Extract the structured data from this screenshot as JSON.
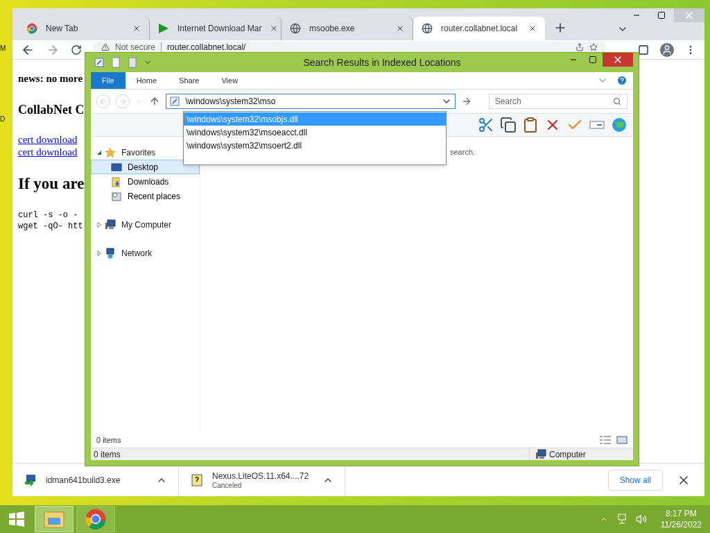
{
  "desktop_labels": [
    "M",
    "D"
  ],
  "browser": {
    "tabs": [
      {
        "title": "New Tab",
        "selected": false
      },
      {
        "title": "Internet Download Mar",
        "selected": false
      },
      {
        "title": "msoobe.exe",
        "selected": false
      },
      {
        "title": "router.collabnet.local",
        "selected": true
      }
    ],
    "security": "Not secure",
    "url": "router.collabnet.local/",
    "page": [
      {
        "kind": "bold",
        "text": "news: no more"
      },
      {
        "kind": "heading",
        "text": "CollabNet C"
      },
      {
        "kind": "link",
        "text": "cert download"
      },
      {
        "kind": "link",
        "text": "cert download"
      },
      {
        "kind": "big",
        "text": "If you are"
      },
      {
        "kind": "code",
        "text": "curl -s -o -"
      },
      {
        "kind": "code",
        "text": "wget -qO- htt"
      }
    ],
    "downloads": [
      {
        "name": "idman641build3.exe"
      },
      {
        "name": "Nexus.LiteOS.11.x64....72",
        "status": "Canceled"
      }
    ],
    "show_all": "Show all"
  },
  "explorer": {
    "title": "Search Results in Indexed Locations",
    "ribbon_tabs": [
      {
        "label": "File",
        "selected": true
      },
      {
        "label": "Home",
        "selected": false
      },
      {
        "label": "Share",
        "selected": false
      },
      {
        "label": "View",
        "selected": false
      }
    ],
    "address": "\\windows\\system32\\mso",
    "search_placeholder": "Search",
    "suggestions": [
      {
        "text": "\\windows\\system32\\msobjs.dll",
        "selected": true
      },
      {
        "text": "\\windows\\system32\\msoeacct.dll",
        "selected": false
      },
      {
        "text": "\\windows\\system32\\msoert2.dll",
        "selected": false
      }
    ],
    "nav": [
      {
        "label": "Favorites",
        "expanded": true,
        "children": [
          {
            "label": "Desktop",
            "selected": true
          },
          {
            "label": "Downloads",
            "selected": false
          },
          {
            "label": "Recent places",
            "selected": false
          }
        ]
      },
      {
        "label": "My Computer",
        "expanded": false
      },
      {
        "label": "Network",
        "expanded": false
      }
    ],
    "message": "search.",
    "item_count": "0 items",
    "status": {
      "count": "0 items",
      "location": "Computer"
    }
  },
  "taskbar": {
    "apps": [
      {
        "selected": true
      },
      {
        "selected": false
      }
    ],
    "time": "8:17 PM",
    "date": "11/26/2022"
  }
}
